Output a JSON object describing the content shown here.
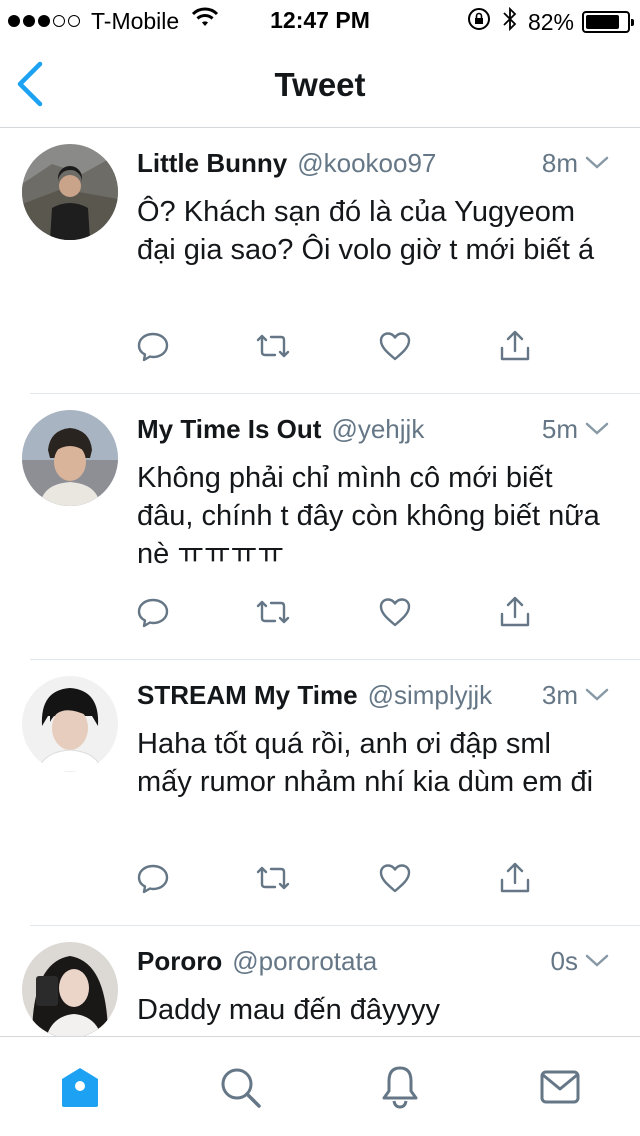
{
  "status_bar": {
    "carrier": "T-Mobile",
    "time": "12:47 PM",
    "battery": "82%",
    "battery_level": 0.82,
    "signal_bars": 3,
    "signal_total": 5
  },
  "nav": {
    "title": "Tweet"
  },
  "tweets": [
    {
      "name": "Little Bunny",
      "handle": "@kookoo97",
      "time": "8m",
      "text": "Ô? Khách sạn đó là của Yugyeom đại gia sao? Ôi volo giờ t mới biết á"
    },
    {
      "name": "My Time Is Out",
      "handle": "@yehjjk",
      "time": "5m",
      "text": "Không phải chỉ mình cô mới biết đâu, chính t đây còn không biết nữa nè ㅠㅠㅠㅠ"
    },
    {
      "name": "STREAM My Time",
      "handle": "@simplyjjk",
      "time": "3m",
      "text": "Haha tốt quá rồi, anh ơi đập sml mấy rumor nhảm nhí kia dùm em đi"
    },
    {
      "name": "Pororo",
      "handle": "@pororotata",
      "time": "0s",
      "text": "Daddy mau đến đâyyyy"
    }
  ],
  "tabs": [
    "home-icon",
    "search-icon",
    "notifications-icon",
    "messages-icon"
  ],
  "colors": {
    "accent": "#1da1f2",
    "secondary_text": "#657786",
    "icon_gray": "#657786"
  }
}
